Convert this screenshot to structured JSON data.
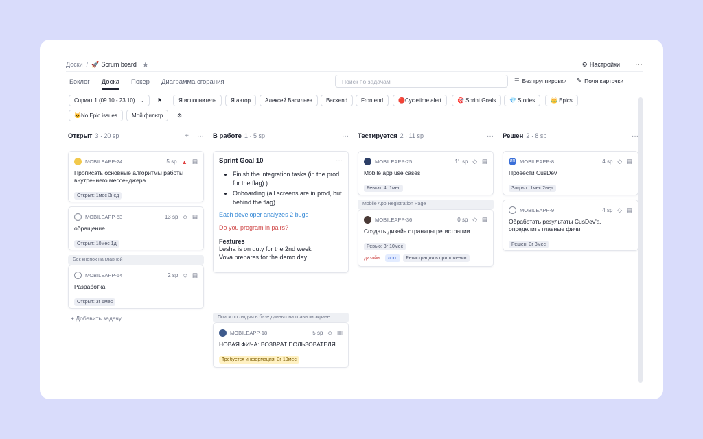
{
  "breadcrumbs": {
    "root": "Доски",
    "sep": "/",
    "current_icon": "🚀",
    "current": "Scrum board"
  },
  "header": {
    "settings": "Настройки",
    "more": "···"
  },
  "tabs": [
    "Бэклог",
    "Доска",
    "Покер",
    "Диаграмма сгорания"
  ],
  "active_tab": "Доска",
  "search": {
    "placeholder": "Поиск по задачам"
  },
  "toolbar": {
    "grouping": "Без группировки",
    "card_fields": "Поля карточки"
  },
  "filters": {
    "sprint": "Спринт 1 (09.10 - 23.10)",
    "chips": [
      "Я исполнитель",
      "Я автор",
      "Алексей Васильев",
      "Backend",
      "Frontend",
      "🔴Cycletime alert",
      "🎯 Sprint Goals",
      "💎 Stories",
      "👑 Epics",
      "😺No Epic issues",
      "Мой фильтр"
    ]
  },
  "columns": [
    {
      "title": "Открыт",
      "meta": "3 · 20 sp",
      "cards": [
        {
          "key": "MOBILEAPP-24",
          "sp": "5 sp",
          "title": "Прописать основные алгоритмы работы внутреннего мессенджера",
          "tag": "Открыт: 1мес 3нед"
        },
        {
          "key": "MOBILEAPP-53",
          "sp": "13 sp",
          "title": "обращение",
          "tag": "Открыт: 10мес 1д"
        },
        {
          "group": "Бек кнопок на главной",
          "key": "MOBILEAPP-54",
          "sp": "2 sp",
          "title": "Разработка",
          "tag": "Открыт: 3г 6мес"
        }
      ],
      "add_task": "Добавить задачу"
    },
    {
      "title": "В работе",
      "meta": "1 · 5 sp",
      "sprint_goal": {
        "title": "Sprint Goal 10",
        "items": [
          "Finish the integration tasks (in the prod for the flag).)",
          "Onboarding (all screens are in prod, but behind the flag)"
        ],
        "blue": "Each developer analyzes 2 bugs",
        "red": "Do you program in pairs?",
        "features_title": "Features",
        "features": [
          "Lesha is on duty for the 2nd week",
          "Vova prepares for the demo day"
        ]
      },
      "cards": [
        {
          "group": "Поиск по людям в базе данных на главном экране",
          "key": "MOBILEAPP-18",
          "sp": "5 sp",
          "title": "НОВАЯ ФИЧА: ВОЗВРАТ ПОЛЬЗОВАТЕЛЯ",
          "tag": "Требуется информация: 3г 10мес"
        }
      ]
    },
    {
      "title": "Тестируется",
      "meta": "2 · 11 sp",
      "cards": [
        {
          "key": "MOBILEAPP-25",
          "sp": "11 sp",
          "title": "Mobile app use cases",
          "tag": "Ревью: 4г 1мес"
        },
        {
          "group": "Mobile App Registration Page",
          "key": "MOBILEAPP-36",
          "sp": "0 sp",
          "title": "Создать дизайн страницы регистрации",
          "tag": "Ревью: 3г 10мес",
          "labels": [
            "дизайн",
            "лого",
            "Регистрация в приложении"
          ]
        }
      ]
    },
    {
      "title": "Решен",
      "meta": "2 · 8 sp",
      "cards": [
        {
          "key": "MOBILEAPP-8",
          "sp": "4 sp",
          "title": "Провести CusDev",
          "tag": "Закрыт: 1мес 2нед",
          "avatar": "ИП"
        },
        {
          "key": "MOBILEAPP-9",
          "sp": "4 sp",
          "title": "Обработать результаты CusDev'а, определить главные фичи",
          "tag": "Решен: 3г 3мес"
        }
      ]
    }
  ],
  "colors": {
    "background": "#d9dcfb",
    "accent": "#3a8bd6",
    "danger": "#d04a4a"
  }
}
